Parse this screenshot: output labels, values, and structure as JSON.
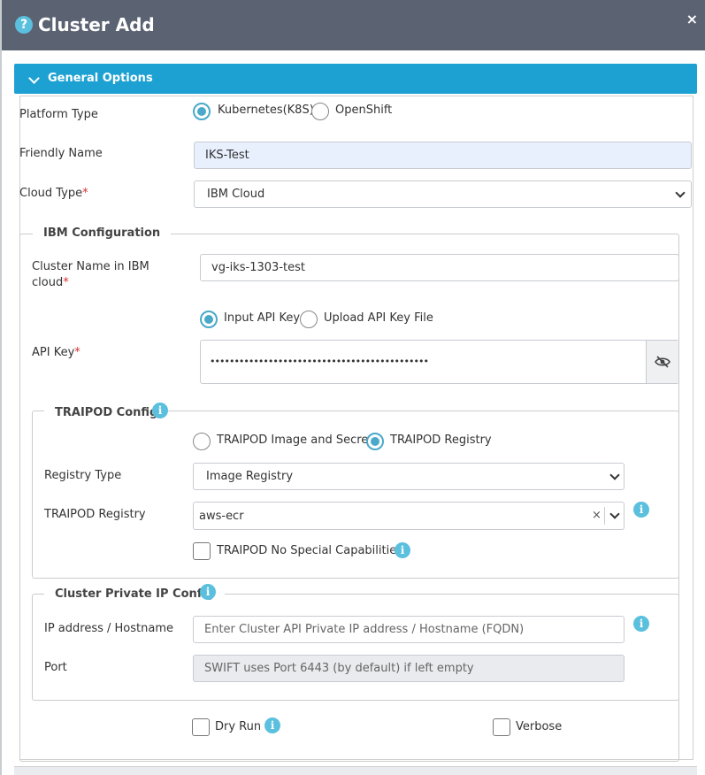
{
  "dialog": {
    "title": "Cluster Add",
    "help_icon": "?",
    "close_icon": "×"
  },
  "section": {
    "label": "General Options"
  },
  "platform": {
    "label": "Platform Type",
    "options": [
      "Kubernetes(K8S)",
      "OpenShift"
    ],
    "selected": "Kubernetes(K8S)"
  },
  "friendly_name": {
    "label": "Friendly Name",
    "value": "IKS-Test"
  },
  "cloud_type": {
    "label": "Cloud Type",
    "required_mark": "*",
    "value": "IBM Cloud"
  },
  "ibm": {
    "legend": "IBM Configuration",
    "cluster_name_label_line1": "Cluster Name in IBM",
    "cluster_name_label_line2": "cloud",
    "required_mark": "*",
    "cluster_name_value": "vg-iks-1303-test",
    "key_options": [
      "Input API Key",
      "Upload API Key File"
    ],
    "key_selected": "Input API Key",
    "api_key_label": "API Key",
    "api_key_value": "•••••••••••••••••••••••••••••••••••••••••••••"
  },
  "traipod": {
    "legend": "TRAIPOD Config",
    "options": [
      "TRAIPOD Image and Secret",
      "TRAIPOD Registry"
    ],
    "selected": "TRAIPOD Registry",
    "registry_type_label": "Registry Type",
    "registry_type_value": "Image Registry",
    "registry_label": "TRAIPOD Registry",
    "registry_value": "aws-ecr",
    "clear_icon": "×",
    "no_special_label": "TRAIPOD No Special Capabilities",
    "no_special_checked": false
  },
  "private_ip": {
    "legend": "Cluster Private IP Config",
    "ip_label": "IP address / Hostname",
    "ip_placeholder": "Enter Cluster API Private IP address / Hostname (FQDN)",
    "port_label": "Port",
    "port_placeholder": "SWIFT uses Port 6443 (by default) if left empty"
  },
  "options": {
    "dry_run_label": "Dry Run",
    "dry_run_checked": false,
    "verbose_label": "Verbose",
    "verbose_checked": false
  },
  "info_icon_glyph": "i",
  "colors": {
    "header": "#5b6373",
    "accent": "#1da1d2",
    "info": "#5bc0de",
    "radio": "#4aa9c9",
    "required": "#d9302c"
  }
}
